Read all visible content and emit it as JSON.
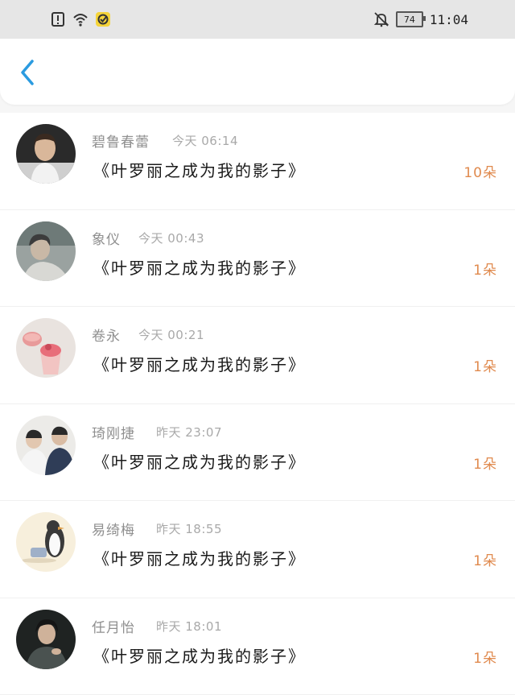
{
  "status_bar": {
    "left_icons": [
      "alert-icon",
      "wifi-icon",
      "app-notification-icon"
    ],
    "right_icons": [
      "bell-muted-icon"
    ],
    "battery_level": "74",
    "time": "11:04"
  },
  "header": {
    "back_icon": "chevron-left-icon",
    "accent_color": "#2b9be0"
  },
  "list": {
    "count_color": "#e08a4e",
    "items": [
      {
        "name": "碧鲁春蕾",
        "time": "今天 06:14",
        "book": "《叶罗丽之成为我的影子》",
        "count": "10朵"
      },
      {
        "name": "象仪",
        "time": "今天 00:43",
        "book": "《叶罗丽之成为我的影子》",
        "count": "1朵"
      },
      {
        "name": "卷永",
        "time": "今天 00:21",
        "book": "《叶罗丽之成为我的影子》",
        "count": "1朵"
      },
      {
        "name": "琦刚捷",
        "time": "昨天 23:07",
        "book": "《叶罗丽之成为我的影子》",
        "count": "1朵"
      },
      {
        "name": "易绮梅",
        "time": "昨天 18:55",
        "book": "《叶罗丽之成为我的影子》",
        "count": "1朵"
      },
      {
        "name": "任月怡",
        "time": "昨天 18:01",
        "book": "《叶罗丽之成为我的影子》",
        "count": "1朵"
      }
    ]
  }
}
